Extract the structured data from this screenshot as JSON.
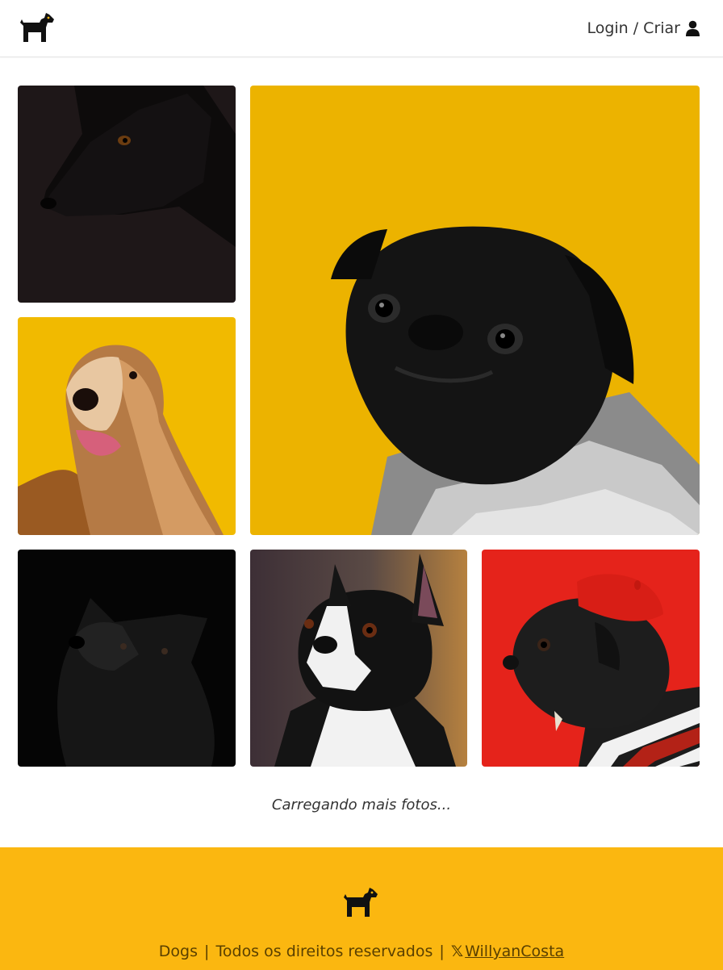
{
  "header": {
    "logo_alt": "Dogs",
    "login_label": "Login / Criar"
  },
  "feed": {
    "photos": [
      {
        "name": "photo-black-dog-profile",
        "bg": "#1e1718"
      },
      {
        "name": "photo-black-pug-yellow",
        "bg": "#ecb300"
      },
      {
        "name": "photo-afghan-hound",
        "bg": "#f1ba00"
      },
      {
        "name": "photo-black-fluffy-dog",
        "bg": "#050505"
      },
      {
        "name": "photo-boston-terrier",
        "bg": "#5a4a45"
      },
      {
        "name": "photo-pug-beret",
        "bg": "#e5231b"
      }
    ],
    "loading_text": "Carregando mais fotos..."
  },
  "footer": {
    "brand": "Dogs",
    "rights": "Todos os direitos reservados",
    "social_icon": "x-icon",
    "social_glyph": "𝕏",
    "social_label": "WillyanCosta",
    "bg_color": "#fbb710"
  }
}
